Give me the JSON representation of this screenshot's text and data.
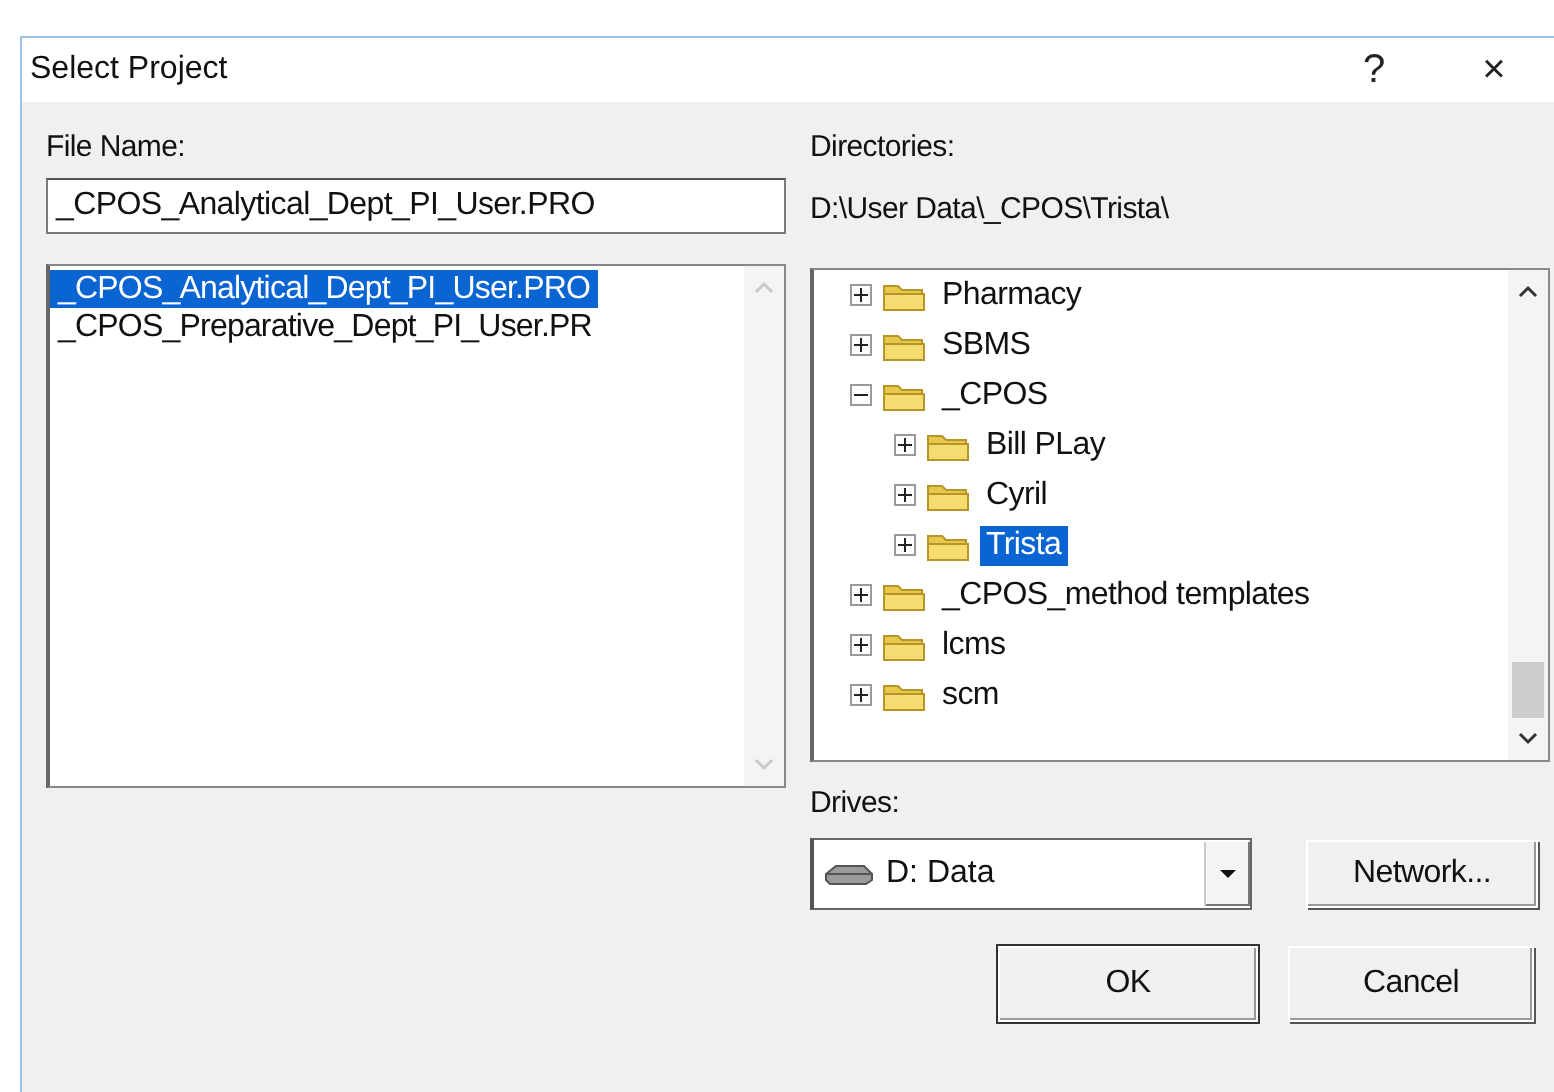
{
  "window": {
    "title": "Select Project",
    "help": "?",
    "close": "×"
  },
  "file_name": {
    "label": "File Name:",
    "value": "_CPOS_Analytical_Dept_PI_User.PRO"
  },
  "files": [
    {
      "name": "_CPOS_Analytical_Dept_PI_User.PRO",
      "selected": true
    },
    {
      "name": "_CPOS_Preparative_Dept_PI_User.PR",
      "selected": false
    }
  ],
  "directories": {
    "label": "Directories:",
    "path": "D:\\User Data\\_CPOS\\Trista\\"
  },
  "tree": [
    {
      "name": "Pharmacy",
      "expanded": false,
      "selected": false
    },
    {
      "name": "SBMS",
      "expanded": false,
      "selected": false
    },
    {
      "name": "_CPOS",
      "expanded": true,
      "selected": false,
      "children": [
        {
          "name": "Bill PLay",
          "expanded": false,
          "selected": false
        },
        {
          "name": "Cyril",
          "expanded": false,
          "selected": false
        },
        {
          "name": "Trista",
          "expanded": false,
          "selected": true
        }
      ]
    },
    {
      "name": "_CPOS_method templates",
      "expanded": false,
      "selected": false
    },
    {
      "name": "lcms",
      "expanded": false,
      "selected": false
    },
    {
      "name": "scm",
      "expanded": false,
      "selected": false
    }
  ],
  "drives": {
    "label": "Drives:",
    "value": "D: Data"
  },
  "buttons": [
    {
      "kind": "network",
      "label": "Network..."
    },
    {
      "kind": "ok",
      "label": "OK"
    },
    {
      "kind": "cancel",
      "label": "Cancel"
    }
  ]
}
